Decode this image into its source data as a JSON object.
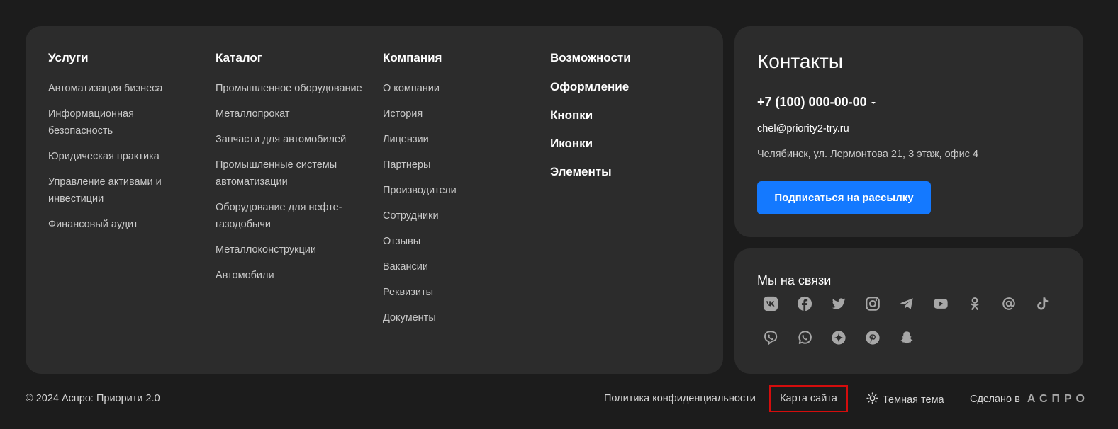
{
  "columns": [
    {
      "title": "Услуги",
      "items": [
        "Автоматизация бизнеса",
        "Информационная безопасность",
        "Юридическая практика",
        "Управление активами и инвестиции",
        "Финансовый аудит"
      ]
    },
    {
      "title": "Каталог",
      "items": [
        "Промышленное оборудование",
        "Металлопрокат",
        "Запчасти для автомобилей",
        "Промышленные системы автоматизации",
        "Оборудование для нефте-газодобычи",
        "Металлоконструкции",
        "Автомобили"
      ]
    },
    {
      "title": "Компания",
      "items": [
        "О компании",
        "История",
        "Лицензии",
        "Партнеры",
        "Производители",
        "Сотрудники",
        "Отзывы",
        "Вакансии",
        "Реквизиты",
        "Документы"
      ]
    },
    {
      "title": "Возможности",
      "items": [
        "Оформление",
        "Кнопки",
        "Иконки",
        "Элементы"
      ]
    }
  ],
  "contacts": {
    "title": "Контакты",
    "phone": "+7 (100) 000-00-00",
    "email": "chel@priority2-try.ru",
    "address": "Челябинск, ул. Лермонтова 21, 3 этаж, офис 4",
    "subscribe_label": "Подписаться на рассылку"
  },
  "social": {
    "title": "Мы на связи",
    "icons": [
      "vk-icon",
      "facebook-icon",
      "twitter-icon",
      "instagram-icon",
      "telegram-icon",
      "youtube-icon",
      "odnoklassniki-icon",
      "mail-icon",
      "tiktok-icon",
      "viber-icon",
      "whatsapp-icon",
      "zen-icon",
      "pinterest-icon",
      "snapchat-icon"
    ]
  },
  "footer": {
    "copyright": "© 2024 Аспро: Приорити 2.0",
    "privacy": "Политика конфиденциальности",
    "sitemap": "Карта сайта",
    "theme": "Темная тема",
    "made_by": "Сделано в",
    "brand": "АСПРО"
  },
  "colors": {
    "background": "#1c1c1c",
    "panel": "#2c2c2c",
    "accent": "#1479ff",
    "icon": "#a7a7a7",
    "highlight": "#d40d0d"
  }
}
